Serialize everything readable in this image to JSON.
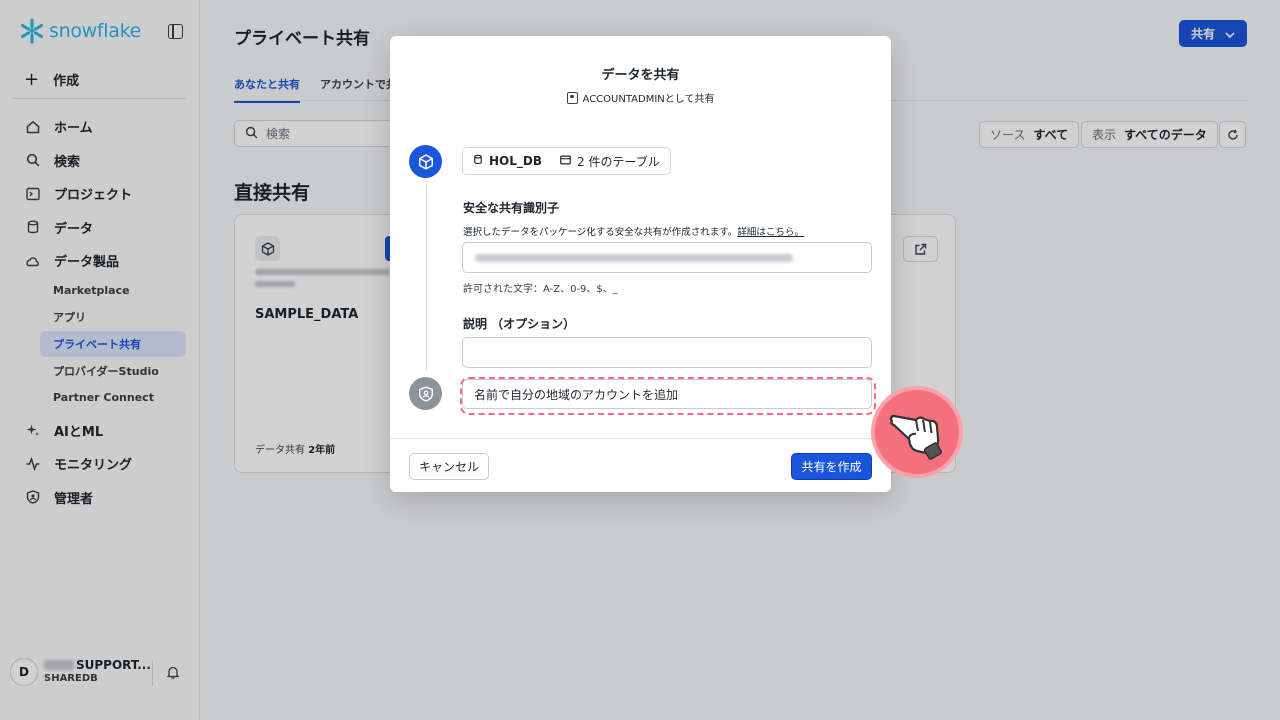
{
  "brand": {
    "name": "snowflake",
    "color": "#29b5e8"
  },
  "sidebar": {
    "toggle_icon": "panel-icon",
    "create_label": "作成",
    "items": [
      {
        "label": "ホーム",
        "icon": "home-icon"
      },
      {
        "label": "検索",
        "icon": "search-icon"
      },
      {
        "label": "プロジェクト",
        "icon": "terminal-icon"
      },
      {
        "label": "データ",
        "icon": "database-icon"
      },
      {
        "label": "データ製品",
        "icon": "cloud-icon"
      }
    ],
    "sub_items": [
      "Marketplace",
      "アプリ",
      "プライベート共有",
      "プロバイダーStudio",
      "Partner Connect"
    ],
    "items_after": [
      {
        "label": "AIとML",
        "icon": "sparkle-icon"
      },
      {
        "label": "モニタリング",
        "icon": "activity-icon"
      },
      {
        "label": "管理者",
        "icon": "shield-icon"
      }
    ],
    "user": {
      "initial": "D",
      "name": "SUPPORT...",
      "role": "SHAREDB"
    }
  },
  "main": {
    "title": "プライベート共有",
    "share_button": "共有",
    "tabs": [
      "あなたと共有",
      "アカウントで共有"
    ],
    "search_placeholder": "検索",
    "filters": {
      "source_key": "ソース",
      "source_value": "すべて",
      "view_key": "表示",
      "view_value": "すべてのデータ"
    },
    "section_title": "直接共有",
    "card": {
      "name": "SAMPLE_DATA",
      "footer_key": "データ共有",
      "footer_value": "2年前"
    }
  },
  "modal": {
    "title": "データを共有",
    "subtitle": "ACCOUNTADMINとして共有",
    "db_chip": "HOL_DB",
    "tables_chip": "2 件のテーブル",
    "identifier_label": "安全な共有識別子",
    "identifier_help": "選択したデータをパッケージ化する安全な共有が作成されます。",
    "identifier_link": "詳細はこちら。",
    "allowed_chars": "許可された文字：A-Z、0-9、$、_",
    "description_label": "説明 （オプション）",
    "add_accounts_placeholder": "名前で自分の地域のアカウントを追加",
    "cancel_label": "キャンセル",
    "create_label": "共有を作成"
  },
  "colors": {
    "accent": "#1a56db",
    "highlight": "#f26b7a"
  }
}
